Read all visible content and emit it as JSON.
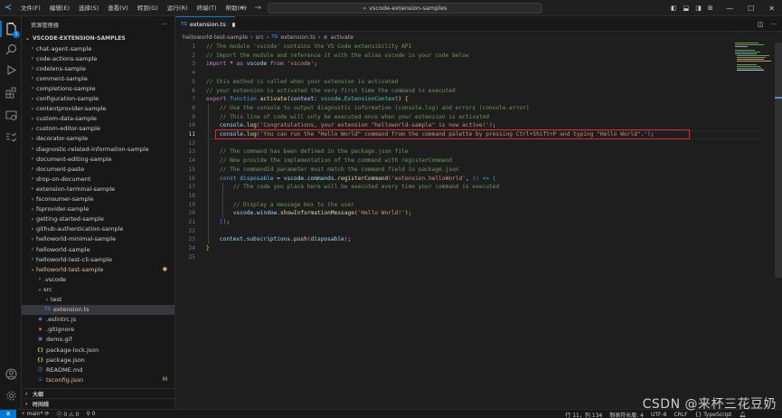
{
  "titlebar": {
    "menu": [
      "文件(F)",
      "编辑(E)",
      "选择(S)",
      "查看(V)",
      "转到(G)",
      "运行(R)",
      "终端(T)",
      "帮助(H)"
    ],
    "search_text": "vscode-extension-samples"
  },
  "activity_bar": {
    "badge": "1"
  },
  "sidebar": {
    "title": "资源管理器",
    "section": "VSCODE-EXTENSION-SAMPLES",
    "tree": [
      {
        "label": "chat-agent-sample",
        "depth": 0,
        "type": "folder",
        "open": false
      },
      {
        "label": "code-actions-sample",
        "depth": 0,
        "type": "folder",
        "open": false
      },
      {
        "label": "codelens-sample",
        "depth": 0,
        "type": "folder",
        "open": false
      },
      {
        "label": "comment-sample",
        "depth": 0,
        "type": "folder",
        "open": false
      },
      {
        "label": "completions-sample",
        "depth": 0,
        "type": "folder",
        "open": false
      },
      {
        "label": "configuration-sample",
        "depth": 0,
        "type": "folder",
        "open": false
      },
      {
        "label": "contentprovider-sample",
        "depth": 0,
        "type": "folder",
        "open": false
      },
      {
        "label": "custom-data-sample",
        "depth": 0,
        "type": "folder",
        "open": false
      },
      {
        "label": "custom-editor-sample",
        "depth": 0,
        "type": "folder",
        "open": false
      },
      {
        "label": "decorator-sample",
        "depth": 0,
        "type": "folder",
        "open": false
      },
      {
        "label": "diagnostic-related-information-sample",
        "depth": 0,
        "type": "folder",
        "open": false
      },
      {
        "label": "document-editing-sample",
        "depth": 0,
        "type": "folder",
        "open": false
      },
      {
        "label": "document-paste",
        "depth": 0,
        "type": "folder",
        "open": false
      },
      {
        "label": "drop-on-document",
        "depth": 0,
        "type": "folder",
        "open": false
      },
      {
        "label": "extension-terminal-sample",
        "depth": 0,
        "type": "folder",
        "open": false
      },
      {
        "label": "fsconsumer-sample",
        "depth": 0,
        "type": "folder",
        "open": false
      },
      {
        "label": "fsprovider-sample",
        "depth": 0,
        "type": "folder",
        "open": false
      },
      {
        "label": "getting-started-sample",
        "depth": 0,
        "type": "folder",
        "open": false
      },
      {
        "label": "github-authentication-sample",
        "depth": 0,
        "type": "folder",
        "open": false
      },
      {
        "label": "helloworld-minimal-sample",
        "depth": 0,
        "type": "folder",
        "open": false
      },
      {
        "label": "helloworld-sample",
        "depth": 0,
        "type": "folder",
        "open": false
      },
      {
        "label": "helloworld-test-cli-sample",
        "depth": 0,
        "type": "folder",
        "open": false
      },
      {
        "label": "helloworld-test-sample",
        "depth": 0,
        "type": "folder",
        "open": true,
        "modified": "●"
      },
      {
        "label": ".vscode",
        "depth": 1,
        "type": "folder",
        "open": false
      },
      {
        "label": "src",
        "depth": 1,
        "type": "folder",
        "open": true
      },
      {
        "label": "test",
        "depth": 2,
        "type": "folder",
        "open": false
      },
      {
        "label": "extension.ts",
        "depth": 2,
        "type": "ts",
        "selected": true
      },
      {
        "label": ".eslintrc.js",
        "depth": 1,
        "type": "eslint"
      },
      {
        "label": ".gitignore",
        "depth": 1,
        "type": "git"
      },
      {
        "label": "demo.gif",
        "depth": 1,
        "type": "gif"
      },
      {
        "label": "package-lock.json",
        "depth": 1,
        "type": "json"
      },
      {
        "label": "package.json",
        "depth": 1,
        "type": "json"
      },
      {
        "label": "README.md",
        "depth": 1,
        "type": "md"
      },
      {
        "label": "tsconfig.json",
        "depth": 1,
        "type": "tsconfig",
        "modified": "M"
      }
    ],
    "outline_label": "大纲",
    "timeline_label": "时间线"
  },
  "tab": {
    "label": "extension.ts",
    "icon": "TS"
  },
  "breadcrumb": [
    "helloworld-test-sample",
    "src",
    "extension.ts",
    "activate"
  ],
  "editor": {
    "active_line": 11,
    "lines": [
      [
        [
          "cm",
          "// The module 'vscode' contains the VS Code extensibility API"
        ]
      ],
      [
        [
          "cm",
          "// Import the module and reference it with the alias vscode in your code below"
        ]
      ],
      [
        [
          "kw2",
          "import"
        ],
        [
          "t",
          " * "
        ],
        [
          "kw2",
          "as"
        ],
        [
          "t",
          " "
        ],
        [
          "var",
          "vscode"
        ],
        [
          "t",
          " "
        ],
        [
          "kw2",
          "from"
        ],
        [
          "t",
          " "
        ],
        [
          "str",
          "'vscode'"
        ],
        [
          "t",
          ";"
        ]
      ],
      [],
      [
        [
          "cm",
          "// this method is called when your extension is activated"
        ]
      ],
      [
        [
          "cm",
          "// your extension is activated the very first time the command is executed"
        ]
      ],
      [
        [
          "kw2",
          "export"
        ],
        [
          "t",
          " "
        ],
        [
          "kw",
          "function"
        ],
        [
          "t",
          " "
        ],
        [
          "fn",
          "activate"
        ],
        [
          "br",
          "("
        ],
        [
          "var",
          "context"
        ],
        [
          "t",
          ": "
        ],
        [
          "ty",
          "vscode"
        ],
        [
          "t",
          "."
        ],
        [
          "ty",
          "ExtensionContext"
        ],
        [
          "br",
          ")"
        ],
        [
          "t",
          " "
        ],
        [
          "br",
          "{"
        ]
      ],
      [
        [
          "t",
          "    "
        ],
        [
          "cm",
          "// Use the console to output diagnostic information (console.log) and errors (console.error)"
        ]
      ],
      [
        [
          "t",
          "    "
        ],
        [
          "cm",
          "// This line of code will only be executed once when your extension is activated"
        ]
      ],
      [
        [
          "t",
          "    "
        ],
        [
          "var",
          "console"
        ],
        [
          "t",
          "."
        ],
        [
          "fn",
          "log"
        ],
        [
          "br2",
          "("
        ],
        [
          "str",
          "'Congratulations, your extension \"helloworld-sample\" is now active!'"
        ],
        [
          "br2",
          ")"
        ],
        [
          "t",
          ";"
        ]
      ],
      [
        [
          "t",
          "    "
        ],
        [
          "var",
          "console"
        ],
        [
          "t",
          "."
        ],
        [
          "fn",
          "log"
        ],
        [
          "br2",
          "("
        ],
        [
          "str",
          "'You can run the \"Hello World\" command from the command palette by pressing Ctrl+Shift+P and typing \"Hello World\".'"
        ],
        [
          "br2",
          ")"
        ],
        [
          "t",
          ";"
        ]
      ],
      [],
      [
        [
          "t",
          "    "
        ],
        [
          "cm",
          "// The command has been defined in the package.json file"
        ]
      ],
      [
        [
          "t",
          "    "
        ],
        [
          "cm",
          "// Now provide the implementation of the command with registerCommand"
        ]
      ],
      [
        [
          "t",
          "    "
        ],
        [
          "cm",
          "// The commandId parameter must match the command field in package.json"
        ]
      ],
      [
        [
          "t",
          "    "
        ],
        [
          "kw",
          "const"
        ],
        [
          "t",
          " "
        ],
        [
          "cst",
          "disposable"
        ],
        [
          "t",
          " = "
        ],
        [
          "var",
          "vscode"
        ],
        [
          "t",
          "."
        ],
        [
          "var",
          "commands"
        ],
        [
          "t",
          "."
        ],
        [
          "fn",
          "registerCommand"
        ],
        [
          "br2",
          "("
        ],
        [
          "str",
          "'extension.helloWorld'"
        ],
        [
          "t",
          ", "
        ],
        [
          "br3",
          "()"
        ],
        [
          "t",
          " "
        ],
        [
          "kw",
          "=>"
        ],
        [
          "t",
          " "
        ],
        [
          "br3",
          "{"
        ]
      ],
      [
        [
          "t",
          "        "
        ],
        [
          "cm",
          "// The code you place here will be executed every time your command is executed"
        ]
      ],
      [],
      [
        [
          "t",
          "        "
        ],
        [
          "cm",
          "// Display a message box to the user"
        ]
      ],
      [
        [
          "t",
          "        "
        ],
        [
          "var",
          "vscode"
        ],
        [
          "t",
          "."
        ],
        [
          "var",
          "window"
        ],
        [
          "t",
          "."
        ],
        [
          "fn",
          "showInformationMessage"
        ],
        [
          "br",
          "("
        ],
        [
          "str",
          "'Hello World!'"
        ],
        [
          "br",
          ")"
        ],
        [
          "t",
          ";"
        ]
      ],
      [
        [
          "t",
          "    "
        ],
        [
          "br3",
          "}"
        ],
        [
          "br2",
          ")"
        ],
        [
          "t",
          ";"
        ]
      ],
      [],
      [
        [
          "t",
          "    "
        ],
        [
          "var",
          "context"
        ],
        [
          "t",
          "."
        ],
        [
          "var",
          "subscriptions"
        ],
        [
          "t",
          "."
        ],
        [
          "fn",
          "push"
        ],
        [
          "br2",
          "("
        ],
        [
          "var",
          "disposable"
        ],
        [
          "br2",
          ")"
        ],
        [
          "t",
          ";"
        ]
      ],
      [
        [
          "br",
          "}"
        ]
      ],
      []
    ]
  },
  "statusbar": {
    "branch": "main*",
    "errors": "0",
    "warnings": "0",
    "ports": "0",
    "position": "行 11，列 134",
    "indent": "制表符长度: 4",
    "encoding": "UTF-8",
    "eol": "CRLF",
    "language": "TypeScript"
  },
  "watermark": "CSDN @来杯三花豆奶"
}
